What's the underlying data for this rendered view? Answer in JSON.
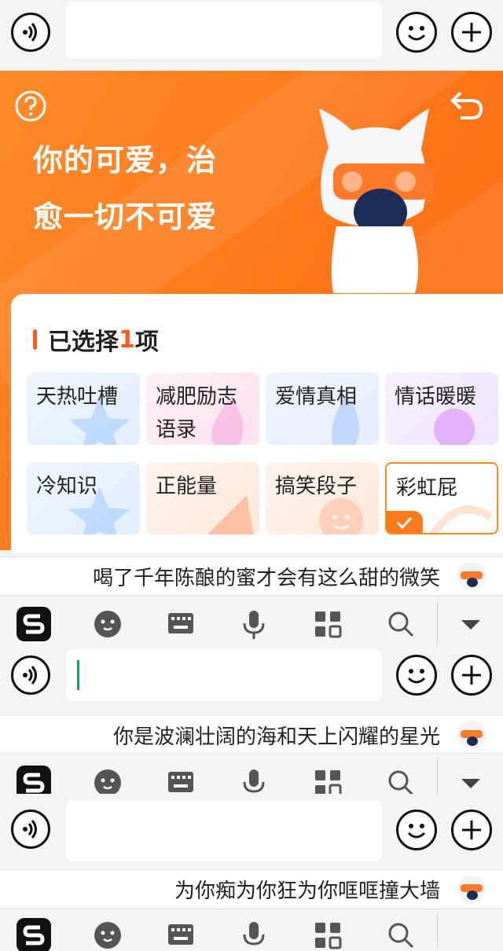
{
  "banner": {
    "slogan_line1": "你的可爱，治",
    "slogan_line2": "愈一切不可爱",
    "accent_color": "#ff6a10"
  },
  "selection": {
    "title_prefix": "已选择",
    "count": "1",
    "title_suffix": "项",
    "tiles": [
      {
        "label": "天热吐槽",
        "selected": false
      },
      {
        "label": "减肥励志语录",
        "selected": false
      },
      {
        "label": "爱情真相",
        "selected": false
      },
      {
        "label": "情话暖暖",
        "selected": false
      },
      {
        "label": "冷知识",
        "selected": false
      },
      {
        "label": "正能量",
        "selected": false
      },
      {
        "label": "搞笑段子",
        "selected": false
      },
      {
        "label": "彩虹屁",
        "selected": true
      }
    ]
  },
  "suggestions": [
    {
      "text": "喝了千年陈酿的蜜才会有这么甜的微笑"
    },
    {
      "text": "你是波澜壮阔的海和天上闪耀的星光"
    },
    {
      "text": "为你痴为你狂为你哐哐撞大墙"
    }
  ],
  "icons": {
    "voice": "voice-icon",
    "emoji": "emoji-icon",
    "plus": "plus-icon",
    "help": "help-icon",
    "back": "back-icon",
    "sogou": "sogou-logo-icon",
    "smiley": "sticker-icon",
    "keyboard": "keyboard-icon",
    "mic": "mic-icon",
    "apps": "apps-grid-icon",
    "search": "search-icon",
    "collapse": "collapse-down-icon"
  }
}
